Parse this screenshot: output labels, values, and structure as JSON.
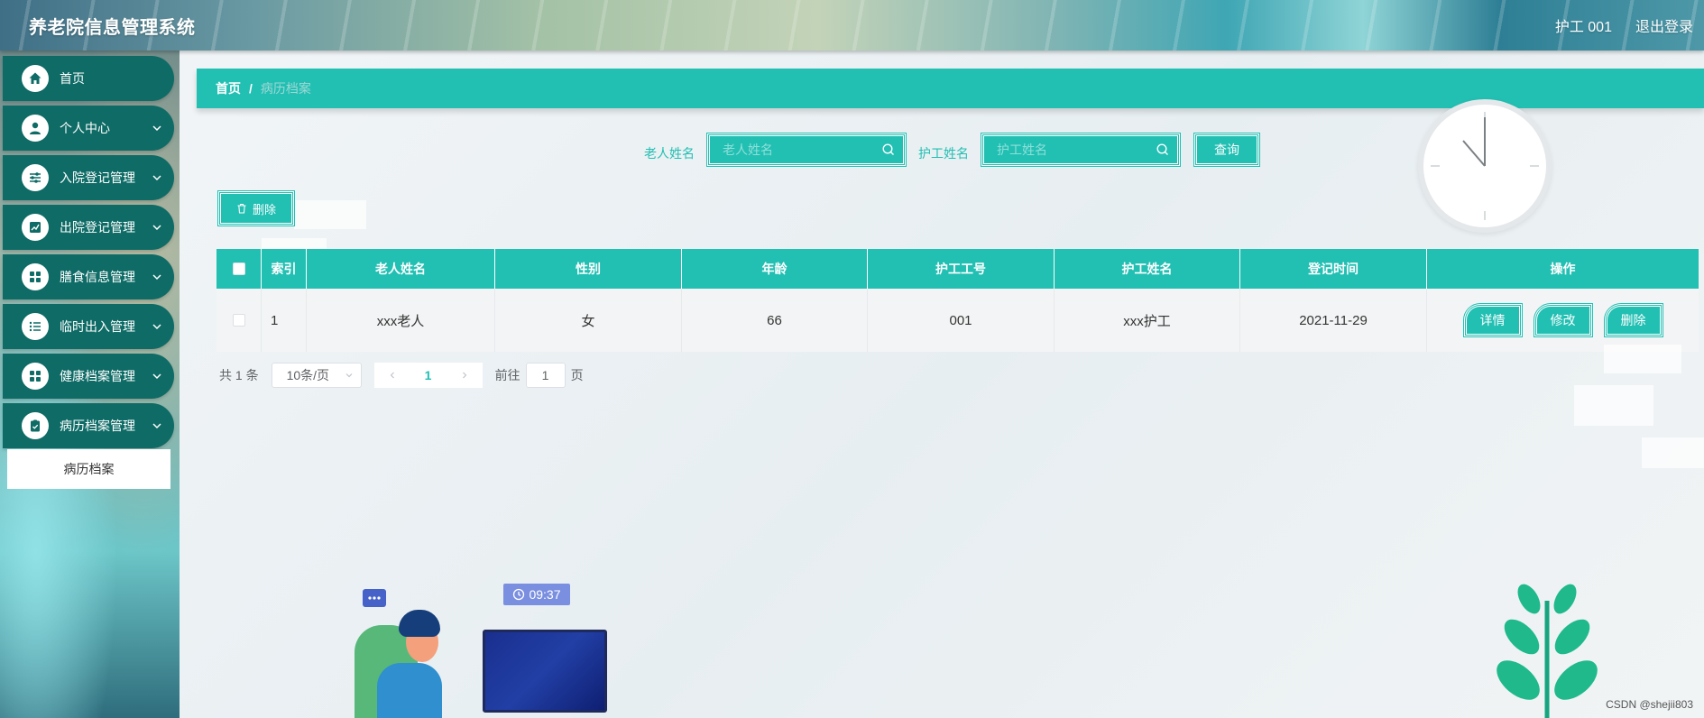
{
  "header": {
    "app_title": "养老院信息管理系统",
    "user_label": "护工 001",
    "logout_label": "退出登录"
  },
  "sidebar": {
    "items": [
      {
        "label": "首页",
        "icon": "home-icon",
        "has_arrow": false
      },
      {
        "label": "个人中心",
        "icon": "user-icon",
        "has_arrow": true
      },
      {
        "label": "入院登记管理",
        "icon": "sliders-icon",
        "has_arrow": true
      },
      {
        "label": "出院登记管理",
        "icon": "chart-icon",
        "has_arrow": true
      },
      {
        "label": "膳食信息管理",
        "icon": "grid-icon",
        "has_arrow": true
      },
      {
        "label": "临时出入管理",
        "icon": "list-icon",
        "has_arrow": true
      },
      {
        "label": "健康档案管理",
        "icon": "grid-icon",
        "has_arrow": true
      },
      {
        "label": "病历档案管理",
        "icon": "clipboard-icon",
        "has_arrow": true
      }
    ],
    "submenu_active": "病历档案"
  },
  "breadcrumb": {
    "home": "首页",
    "separator": "/",
    "current": "病历档案"
  },
  "search": {
    "elder_label": "老人姓名",
    "elder_placeholder": "老人姓名",
    "nurse_label": "护工姓名",
    "nurse_placeholder": "护工姓名",
    "query_label": "查询"
  },
  "toolbar": {
    "delete_label": "删除"
  },
  "table": {
    "headers": [
      "索引",
      "老人姓名",
      "性别",
      "年龄",
      "护工工号",
      "护工姓名",
      "登记时间",
      "操作"
    ],
    "rows": [
      {
        "index": "1",
        "elder_name": "xxx老人",
        "gender": "女",
        "age": "66",
        "nurse_id": "001",
        "nurse_name": "xxx护工",
        "date": "2021-11-29"
      }
    ],
    "actions": {
      "detail": "详情",
      "edit": "修改",
      "delete": "删除"
    }
  },
  "pagination": {
    "total": "共 1 条",
    "page_size": "10条/页",
    "current_page": "1",
    "goto_prefix": "前往",
    "goto_value": "1",
    "goto_suffix": "页"
  },
  "illustration": {
    "time": "09:37"
  },
  "watermark": "CSDN @shejii803",
  "colors": {
    "accent": "#22bfb3",
    "sidebar_item": "#0e6b66"
  }
}
